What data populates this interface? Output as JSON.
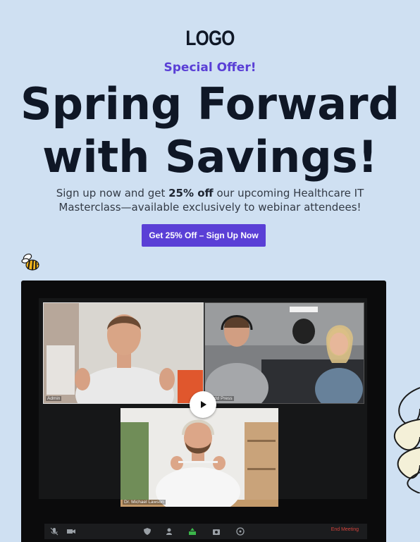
{
  "header": {
    "logo": "LOGO",
    "eyebrow": "Special Offer!",
    "headline_line1": "Spring Forward",
    "headline_line2": "with Savings!",
    "sub_pre": "Sign up now and get ",
    "sub_bold": "25% off",
    "sub_post": " our upcoming Healthcare IT Masterclass—available exclusively to webinar attendees!",
    "cta_label": "Get 25% Off – Sign Up Now"
  },
  "meeting": {
    "participants": [
      {
        "label": "Admin"
      },
      {
        "label": "Podd Press"
      },
      {
        "label": "Dr. Michael Lawson"
      }
    ],
    "toolbar_icons": [
      "mic-muted-icon",
      "camera-icon",
      "shield-icon",
      "participants-icon",
      "share-icon",
      "record-icon",
      "reactions-icon"
    ],
    "end_label": "End Meeting"
  },
  "colors": {
    "background": "#cfe0f2",
    "accent": "#5a3fd6",
    "end_meeting": "#d3433c"
  }
}
